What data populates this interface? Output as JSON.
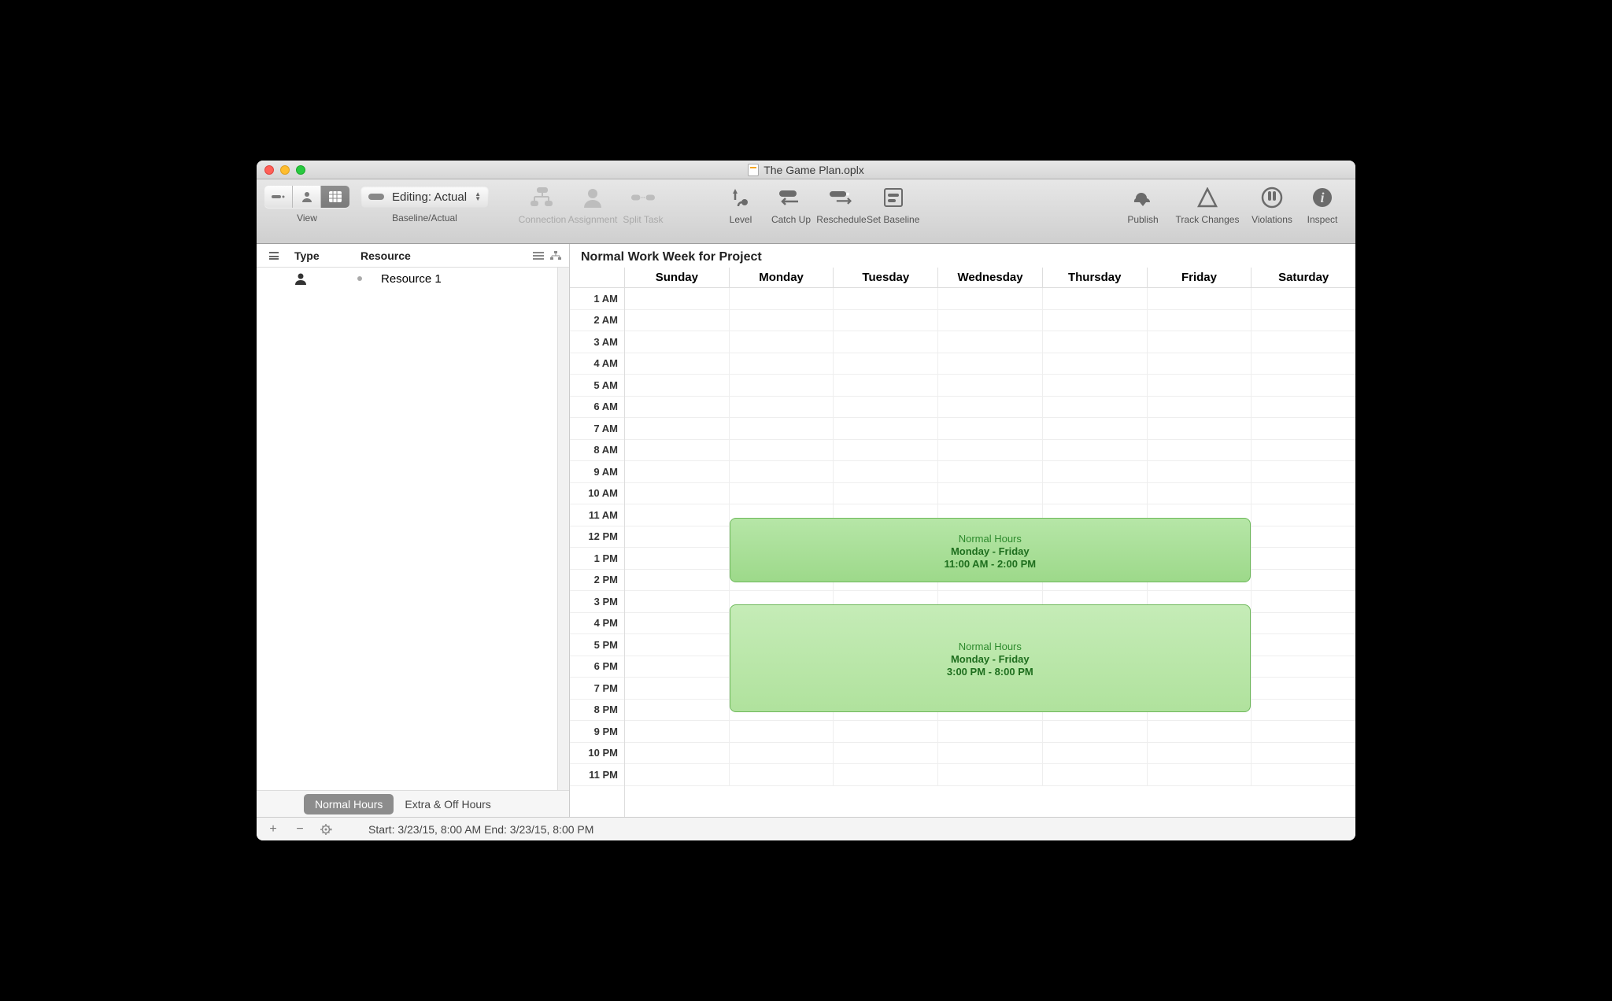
{
  "window": {
    "title": "The Game Plan.oplx"
  },
  "toolbar": {
    "view_label": "View",
    "baseline_label": "Baseline/Actual",
    "editing_label": "Editing: Actual",
    "items": {
      "connection": "Connection",
      "assignment": "Assignment",
      "split_task": "Split Task",
      "level": "Level",
      "catch_up": "Catch Up",
      "reschedule": "Reschedule",
      "set_baseline": "Set Baseline",
      "publish": "Publish",
      "track_changes": "Track Changes",
      "violations": "Violations",
      "inspect": "Inspect"
    }
  },
  "sidebar": {
    "header": {
      "type": "Type",
      "resource": "Resource"
    },
    "rows": [
      {
        "label": "Resource 1"
      }
    ],
    "tabs": {
      "normal": "Normal Hours",
      "extra": "Extra & Off Hours"
    }
  },
  "calendar": {
    "title": "Normal Work Week for Project",
    "days": [
      "Sunday",
      "Monday",
      "Tuesday",
      "Wednesday",
      "Thursday",
      "Friday",
      "Saturday"
    ],
    "hours": [
      "1 AM",
      "2 AM",
      "3 AM",
      "4 AM",
      "5 AM",
      "6 AM",
      "7 AM",
      "8 AM",
      "9 AM",
      "10 AM",
      "11 AM",
      "12 PM",
      "1 PM",
      "2 PM",
      "3 PM",
      "4 PM",
      "5 PM",
      "6 PM",
      "7 PM",
      "8 PM",
      "9 PM",
      "10 PM",
      "11 PM"
    ],
    "events": [
      {
        "title": "Normal Hours",
        "subtitle": "Monday - Friday",
        "time": "11:00 AM - 2:00 PM"
      },
      {
        "title": "Normal Hours",
        "subtitle": "Monday - Friday",
        "time": "3:00 PM - 8:00 PM"
      }
    ]
  },
  "status": {
    "text": "Start: 3/23/15, 8:00 AM End: 3/23/15, 8:00 PM"
  }
}
